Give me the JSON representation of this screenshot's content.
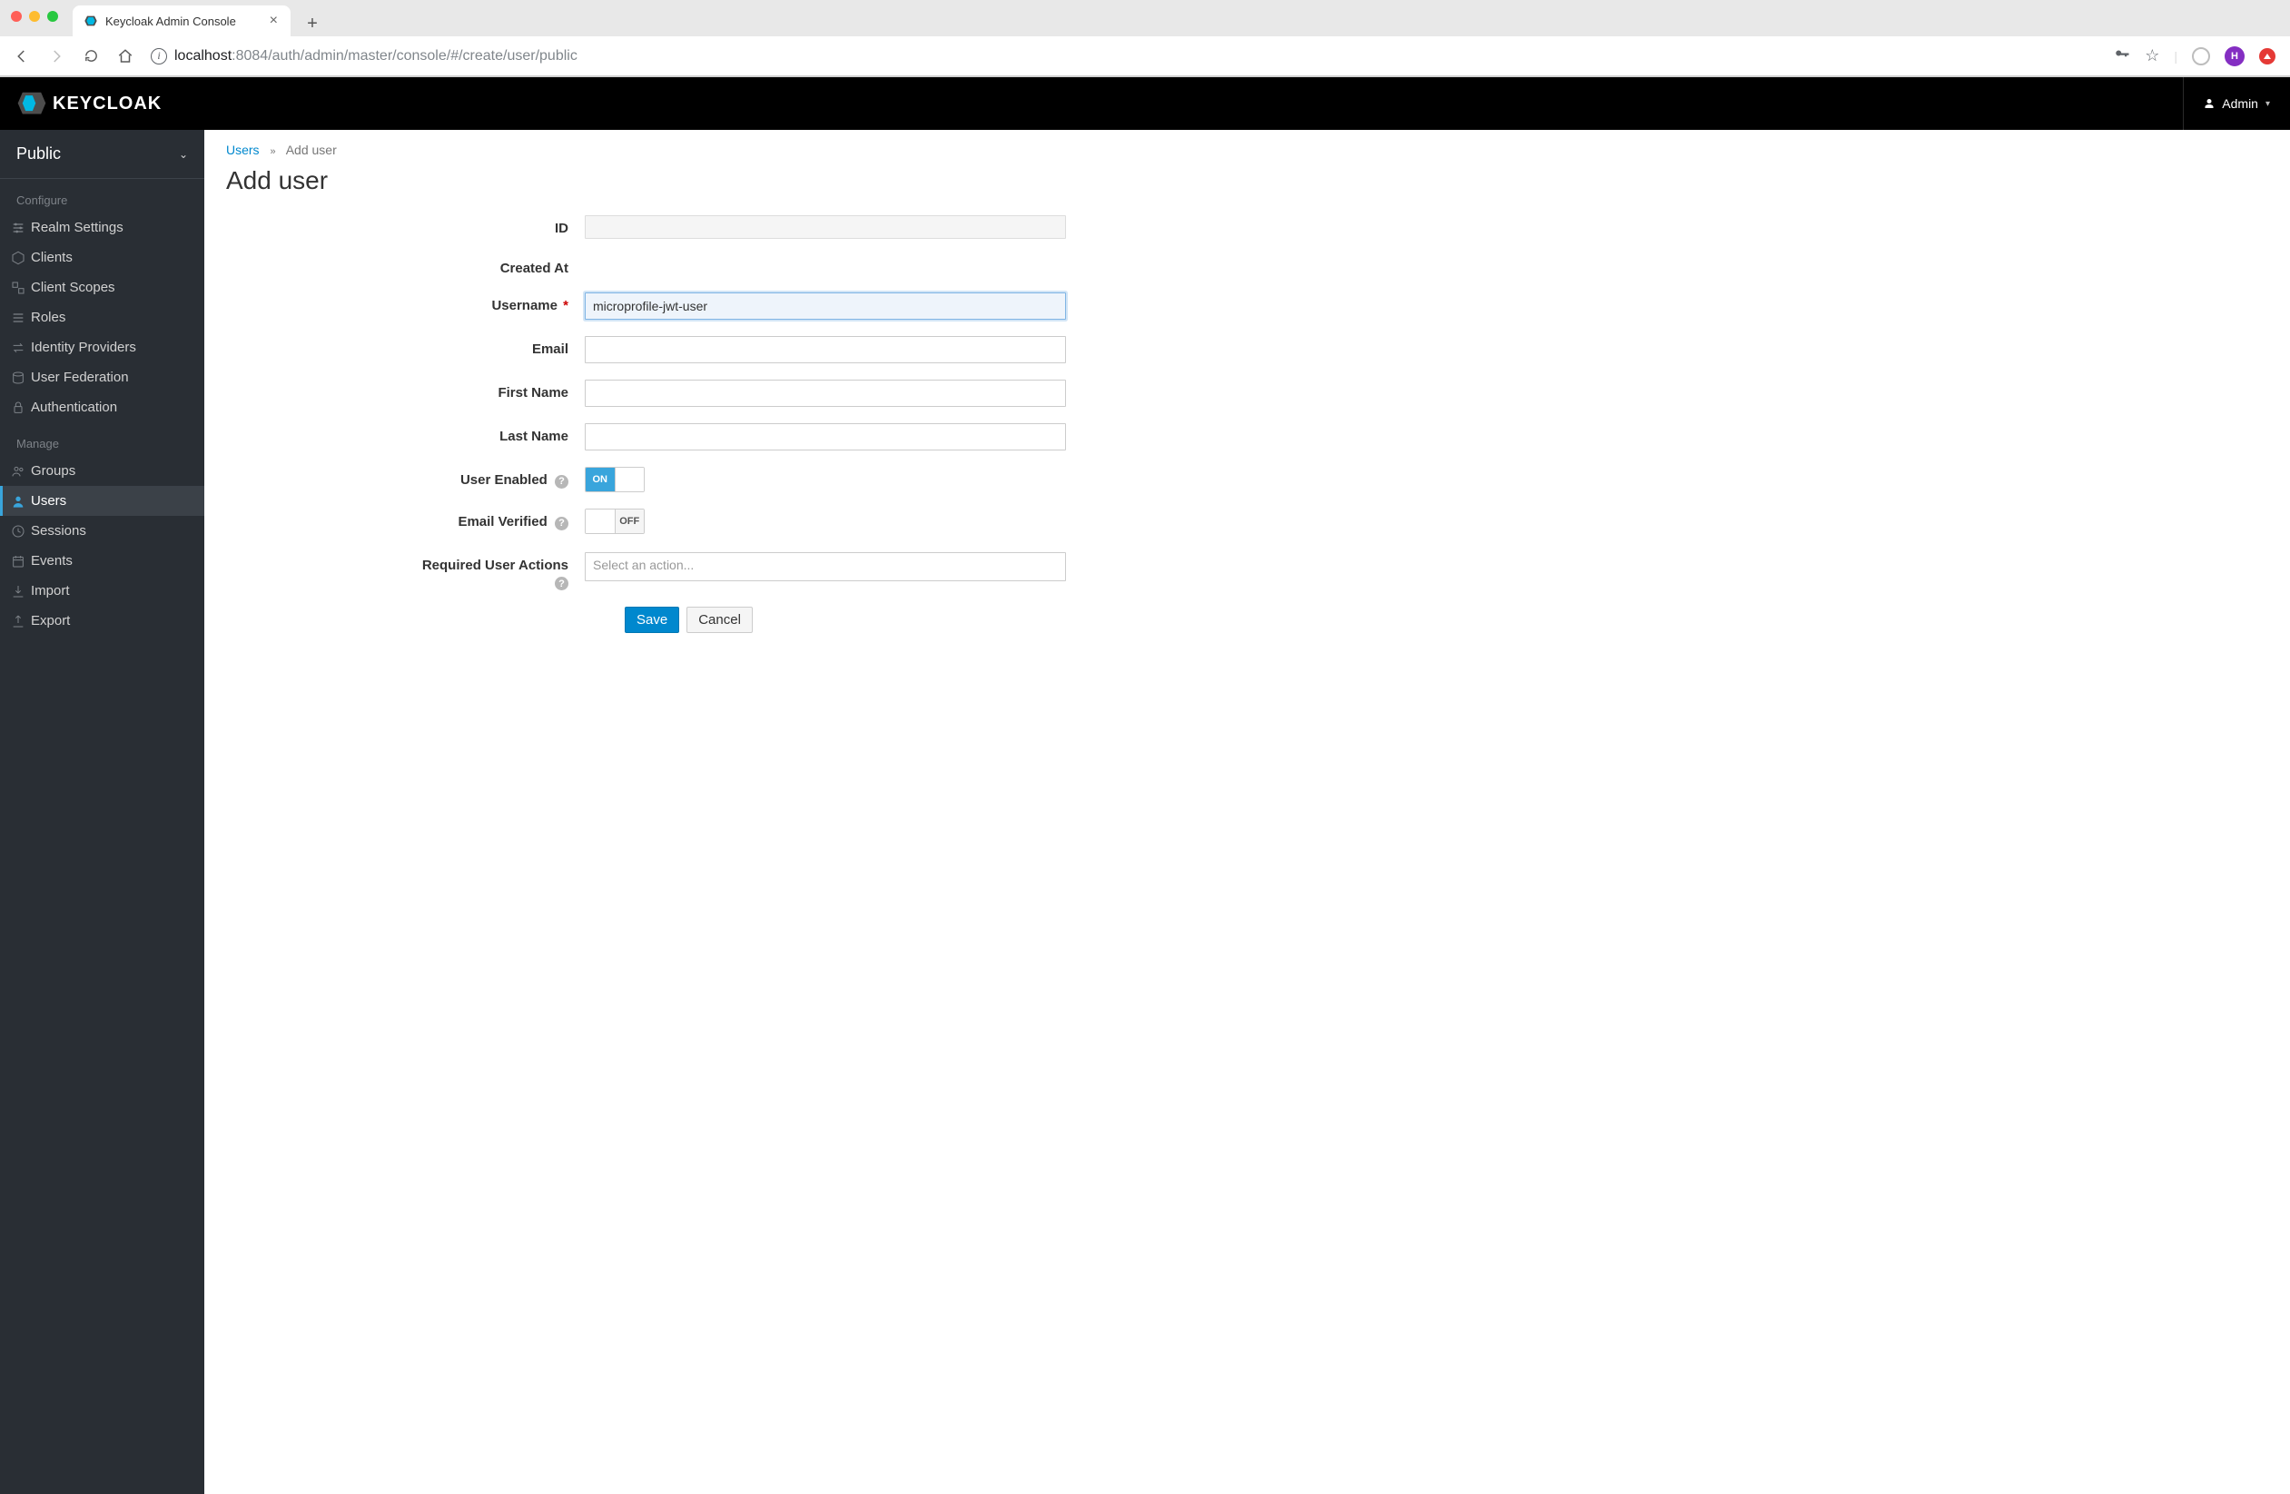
{
  "browser": {
    "tab_title": "Keycloak Admin Console",
    "url_host": "localhost",
    "url_rest": ":8084/auth/admin/master/console/#/create/user/public",
    "profile_initial": "H"
  },
  "header": {
    "brand": "KEYCLOAK",
    "user_label": "Admin"
  },
  "sidebar": {
    "realm": "Public",
    "section_configure": "Configure",
    "section_manage": "Manage",
    "configure_items": [
      "Realm Settings",
      "Clients",
      "Client Scopes",
      "Roles",
      "Identity Providers",
      "User Federation",
      "Authentication"
    ],
    "manage_items": [
      "Groups",
      "Users",
      "Sessions",
      "Events",
      "Import",
      "Export"
    ]
  },
  "breadcrumb": {
    "parent": "Users",
    "current": "Add user"
  },
  "page": {
    "title": "Add user"
  },
  "form": {
    "id_label": "ID",
    "id_value": "",
    "created_at_label": "Created At",
    "username_label": "Username",
    "username_value": "microprofile-jwt-user",
    "email_label": "Email",
    "email_value": "",
    "first_name_label": "First Name",
    "first_name_value": "",
    "last_name_label": "Last Name",
    "last_name_value": "",
    "user_enabled_label": "User Enabled",
    "user_enabled_on": "ON",
    "email_verified_label": "Email Verified",
    "email_verified_off": "OFF",
    "required_actions_label": "Required User Actions",
    "required_actions_placeholder": "Select an action...",
    "save_label": "Save",
    "cancel_label": "Cancel"
  }
}
